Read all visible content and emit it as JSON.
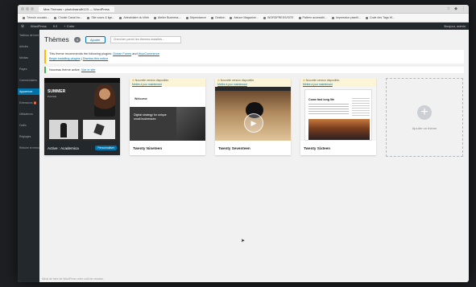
{
  "browser": {
    "tab_title": "Mes Thèmes ‹ photobrandfr123 — WordPress",
    "bookmarks": [
      "Témoin occasio...",
      "Choisir Canal inc...",
      "Site cours & lign...",
      "Abécédaire du Web",
      "Atelier Business...",
      "Dépendance",
      "Gestion",
      "Astuce Magazine...",
      "WORDPRESS/SITE",
      "Pattern accessibl...",
      "Impression plantil...",
      "Code des Tags W..."
    ]
  },
  "adminbar": {
    "left": "WordPress",
    "counts": "5  0",
    "new": "+ Créer",
    "right": "Bonjour, admin"
  },
  "sidebar": {
    "items": [
      "Tableau de bord",
      "Articles",
      "Médias",
      "Pages",
      "Commentaires",
      "Apparence",
      "Extensions",
      "Utilisateurs",
      "Outils",
      "Réglages",
      "Réduire le menu"
    ],
    "badge": "2"
  },
  "header": {
    "title": "Thèmes",
    "count": "4",
    "add_label": "Ajouter",
    "search_placeholder": "Chercher parmi les thèmes installés..."
  },
  "notice": {
    "text": "This theme recommends the following plugins:",
    "plugin_1": "Ocean Forms",
    "and": "and",
    "plugin_2": "WooCommerce",
    "link_1": "Begin installing plugins",
    "link_2": "Dismiss this notice"
  },
  "notice2": {
    "text": "Nouveau thème activé.",
    "link": "Voir le site"
  },
  "themes": [
    {
      "name": "Active : Academica",
      "button": "Personnaliser",
      "shot_heading": "SUMMER",
      "shot_sub": "Portraits"
    },
    {
      "name": "Twenty Nineteen",
      "update": "Nouvelle version disponible.",
      "update_link": "Mettre à jour maintenant",
      "shot_heading": "Welcome",
      "shot_sub": "Digital strategy for unique small businesses"
    },
    {
      "name": "Twenty Seventeen",
      "update": "Nouvelle version disponible.",
      "update_link": "Mettre à jour maintenant"
    },
    {
      "name": "Twenty Sixteen",
      "update": "Nouvelle version disponible.",
      "update_link": "Mettre à jour maintenant",
      "shot_heading": "Come fast long life"
    }
  ],
  "add_theme": "Ajouter un thème",
  "footer_text": "Merci de faire de WordPress votre outil de création.",
  "colors": {
    "accent": "#0073aa",
    "adminbar": "#23282d",
    "warning": "#ffb900"
  }
}
